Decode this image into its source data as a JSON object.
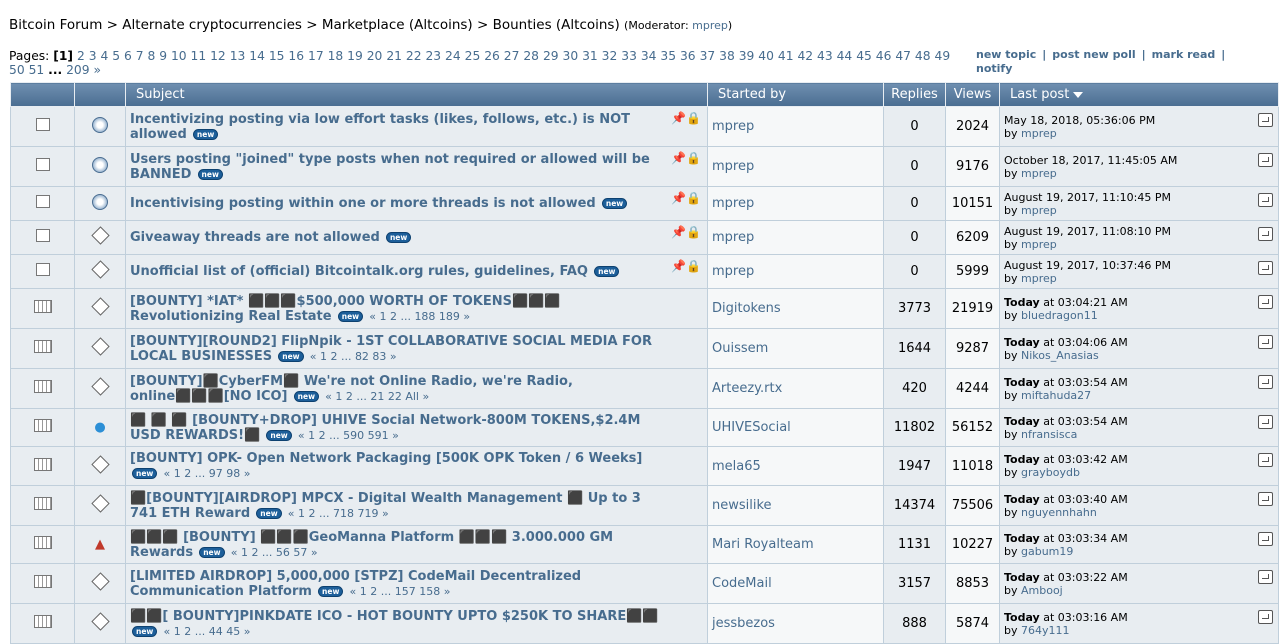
{
  "breadcrumb": {
    "forum": "Bitcoin Forum",
    "sep": " > ",
    "alt": "Alternate cryptocurrencies",
    "market": "Marketplace (Altcoins)",
    "bounties": "Bounties (Altcoins)",
    "mod_label": "(Moderator: ",
    "mod_name": "mprep",
    "mod_close": ")"
  },
  "pages": {
    "label": "Pages: ",
    "current": "[1]",
    "list": [
      "2",
      "3",
      "4",
      "5",
      "6",
      "7",
      "8",
      "9",
      "10",
      "11",
      "12",
      "13",
      "14",
      "15",
      "16",
      "17",
      "18",
      "19",
      "20",
      "21",
      "22",
      "23",
      "24",
      "25",
      "26",
      "27",
      "28",
      "29",
      "30",
      "31",
      "32",
      "33",
      "34",
      "35",
      "36",
      "37",
      "38",
      "39",
      "40",
      "41",
      "42",
      "43",
      "44",
      "45",
      "46",
      "47",
      "48",
      "49",
      "50",
      "51"
    ],
    "ellipsis": "...",
    "last": "209",
    "next": "»"
  },
  "actions": {
    "new_topic": "new topic",
    "new_poll": "post new poll",
    "mark_read": "mark read",
    "notify": "notify",
    "sep": "|"
  },
  "table": {
    "subject": "Subject",
    "started_by": "Started by",
    "replies": "Replies",
    "views": "Views",
    "last_post": "Last post"
  },
  "rows": [
    {
      "title": "Incentivizing posting via low effort tasks (likes, follows, etc.) is NOT allowed",
      "new": "new",
      "pages": "",
      "starter": "mprep",
      "replies": "0",
      "views": "2024",
      "date": "May 18, 2018, 05:36:06 PM",
      "by": "by ",
      "user": "mprep",
      "sticky": true
    },
    {
      "title": "Users posting \"joined\" type posts when not required or allowed will be BANNED",
      "new": "new",
      "pages": "",
      "starter": "mprep",
      "replies": "0",
      "views": "9176",
      "date": "October 18, 2017, 11:45:05 AM",
      "by": "by ",
      "user": "mprep",
      "sticky": true
    },
    {
      "title": "Incentivising posting within one or more threads is not allowed",
      "new": "new",
      "pages": "",
      "starter": "mprep",
      "replies": "0",
      "views": "10151",
      "date": "August 19, 2017, 11:10:45 PM",
      "by": "by ",
      "user": "mprep",
      "sticky": true
    },
    {
      "title": "Giveaway threads are not allowed",
      "new": "new",
      "pages": "",
      "starter": "mprep",
      "replies": "0",
      "views": "6209",
      "date": "August 19, 2017, 11:08:10 PM",
      "by": "by ",
      "user": "mprep",
      "sticky": true
    },
    {
      "title": "Unofficial list of (official) Bitcointalk.org rules, guidelines, FAQ",
      "new": "new",
      "pages": "",
      "starter": "mprep",
      "replies": "0",
      "views": "5999",
      "date": "August 19, 2017, 10:37:46 PM",
      "by": "by ",
      "user": "mprep",
      "sticky": true
    },
    {
      "title": "[BOUNTY] *IAT* ⬛⬛⬛$500,000 WORTH OF TOKENS⬛⬛⬛ Revolutionizing Real Estate",
      "new": "new",
      "pages": "« 1 2 ... 188 189 »",
      "starter": "Digitokens",
      "replies": "3773",
      "views": "21919",
      "today": "Today",
      "date": " at 03:04:21 AM",
      "by": "by ",
      "user": "bluedragon11"
    },
    {
      "title": "[BOUNTY][ROUND2] FlipNpik - 1ST COLLABORATIVE SOCIAL MEDIA FOR LOCAL BUSINESSES",
      "new": "new",
      "pages": "« 1 2 ... 82 83 »",
      "starter": "Ouissem",
      "replies": "1644",
      "views": "9287",
      "today": "Today",
      "date": " at 03:04:06 AM",
      "by": "by ",
      "user": "Nikos_Anasias"
    },
    {
      "title": "[BOUNTY]⬛CyberFM⬛ We're not Online Radio, we're Radio, online⬛⬛⬛[NO ICO]",
      "new": "new",
      "pages": "« 1 2 ... 21 22  All »",
      "starter": "Arteezy.rtx",
      "replies": "420",
      "views": "4244",
      "today": "Today",
      "date": " at 03:03:54 AM",
      "by": "by ",
      "user": "miftahuda27"
    },
    {
      "title": "⬛ ⬛ ⬛ [BOUNTY+DROP] UHIVE Social Network-800M TOKENS,$2.4M USD REWARDS!⬛",
      "new": "new",
      "pages": "« 1 2 ... 590 591 »",
      "starter": "UHIVESocial",
      "replies": "11802",
      "views": "56152",
      "today": "Today",
      "date": " at 03:03:54 AM",
      "by": "by ",
      "user": "nfransisca"
    },
    {
      "title": "[BOUNTY] OPK- Open Network Packaging [500K OPK Token / 6 Weeks]",
      "new": "new",
      "pages": "« 1 2 ... 97 98 »",
      "starter": "mela65",
      "replies": "1947",
      "views": "11018",
      "today": "Today",
      "date": " at 03:03:42 AM",
      "by": "by ",
      "user": "grayboydb"
    },
    {
      "title": "⬛[BOUNTY][AIRDROP] MPCX - Digital Wealth Management ⬛ Up to 3 741 ETH Reward",
      "new": "new",
      "pages": "« 1 2 ... 718 719 »",
      "starter": "newsilike",
      "replies": "14374",
      "views": "75506",
      "today": "Today",
      "date": " at 03:03:40 AM",
      "by": "by ",
      "user": "nguyennhahn"
    },
    {
      "title": "⬛⬛⬛ [BOUNTY] ⬛⬛⬛GeoManna Platform ⬛⬛⬛ 3.000.000 GM Rewards",
      "new": "new",
      "pages": "« 1 2 ... 56 57 »",
      "starter": "Mari Royalteam",
      "replies": "1131",
      "views": "10227",
      "today": "Today",
      "date": " at 03:03:34 AM",
      "by": "by ",
      "user": "gabum19"
    },
    {
      "title": "[LIMITED AIRDROP] 5,000,000 [STPZ] CodeMail Decentralized Communication Platform",
      "new": "new",
      "pages": "« 1 2 ... 157 158 »",
      "starter": "CodeMail",
      "replies": "3157",
      "views": "8853",
      "today": "Today",
      "date": " at 03:03:22 AM",
      "by": "by ",
      "user": "Ambooj"
    },
    {
      "title": "⬛⬛[ BOUNTY]PINKDATE ICO - HOT BOUNTY UPTO $250K TO SHARE⬛⬛",
      "new": "new",
      "pages": "« 1 2 ... 44 45 »",
      "starter": "jessbezos",
      "replies": "888",
      "views": "5874",
      "today": "Today",
      "date": " at 03:03:16 AM",
      "by": "by ",
      "user": "764y111"
    }
  ]
}
